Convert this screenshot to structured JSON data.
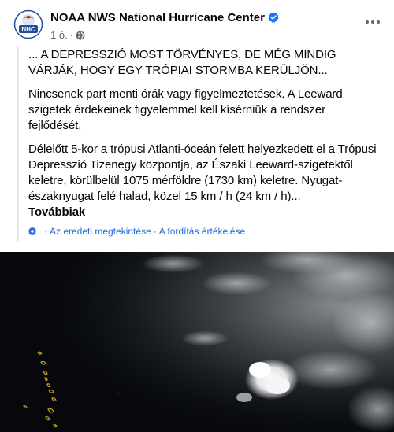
{
  "post": {
    "page_name": "NOAA NWS National Hurricane Center",
    "avatar_text": "NHC",
    "timestamp": "1 ó.",
    "meta_dot": "·",
    "paragraphs": [
      "... A DEPRESSZIÓ MOST TÖRVÉNYES, DE MÉG MINDIG VÁRJÁK, HOGY EGY TRÓPIAI STORMBA KERÜLJÖN...",
      "Nincsenek part menti órák vagy figyelmeztetések. A Leeward szigetek érdekeinek figyelemmel kell kísérniük a rendszer fejlődését.",
      "Délelőtt 5-kor a trópusi Atlanti-óceán felett helyezkedett el a Trópusi Depresszió Tizenegy központja, az Északi Leeward-szigetektől keletre, körülbelül 1075 mérföldre (1730 km) keletre. Nyugat-északnyugat felé halad, közel 15 km / h (24 km / h)..."
    ],
    "see_more": "Továbbiak"
  },
  "translation": {
    "view_original": "Az eredeti megtekintése",
    "separator": "·",
    "rate_translation": "A fordítás értékelése"
  },
  "colors": {
    "link": "#216fdb",
    "verified": "#1877f2",
    "secondary_text": "#65676b",
    "quote_bar": "#e4e6eb"
  },
  "icons": {
    "verified": "verified-badge-icon",
    "audience": "globe-icon",
    "menu": "more-dots-icon",
    "translate": "gear-icon"
  }
}
